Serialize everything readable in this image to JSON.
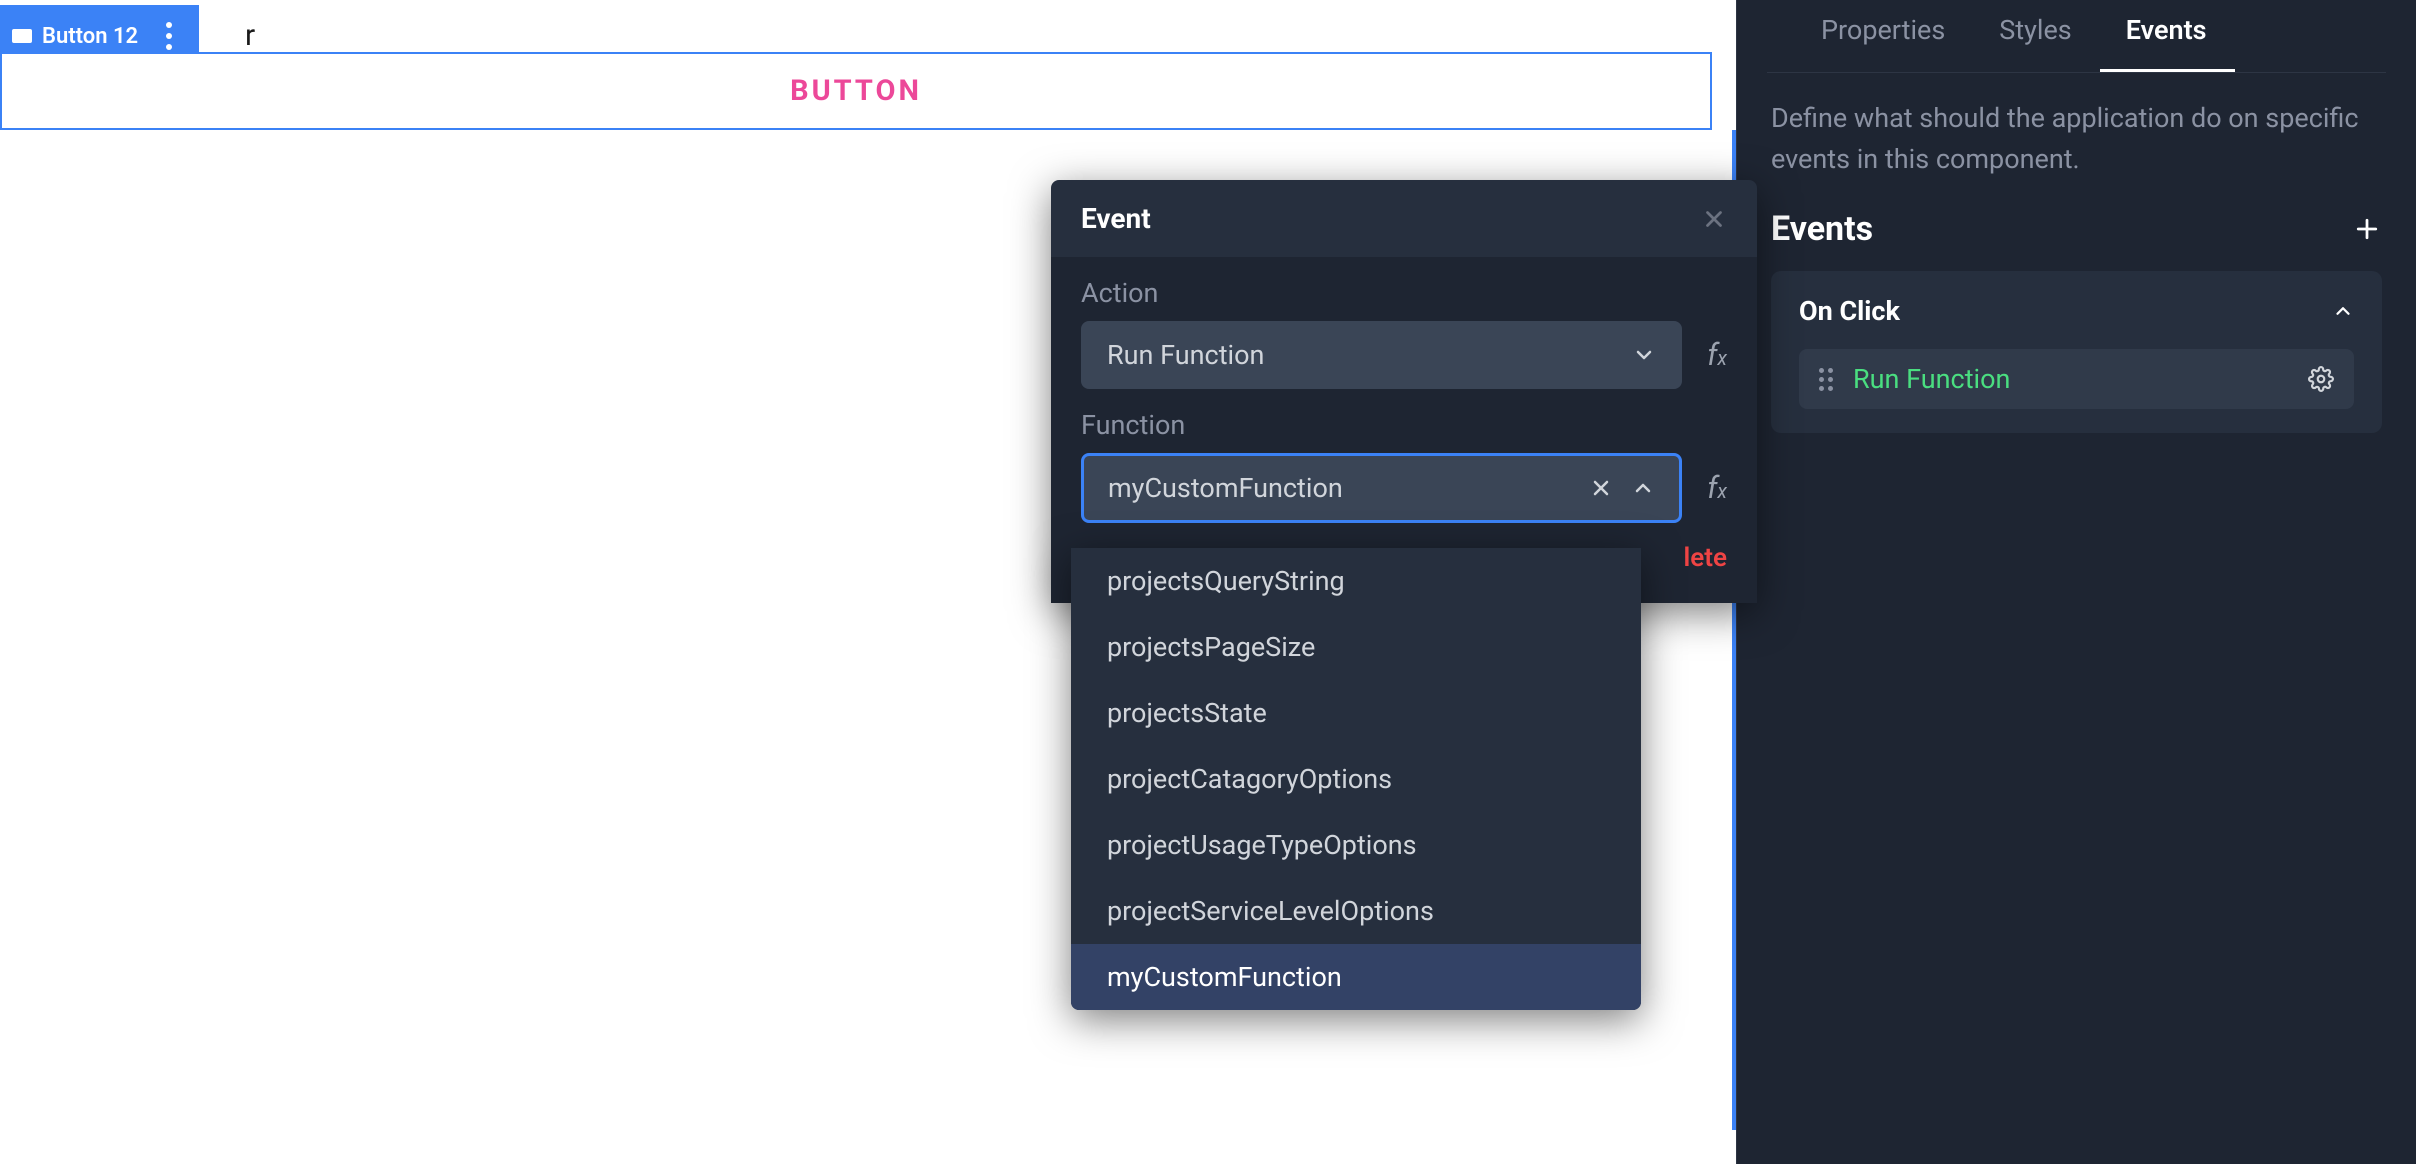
{
  "canvas": {
    "selection_label": "Button 12",
    "background_text": "r",
    "button_text": "BUTTON"
  },
  "inspector": {
    "tabs": {
      "properties": "Properties",
      "styles": "Styles",
      "events": "Events"
    },
    "description": "Define what should the application do on specific events in this component.",
    "events_heading": "Events",
    "event": {
      "name": "On Click",
      "action": "Run Function"
    }
  },
  "event_panel": {
    "title": "Event",
    "action_label": "Action",
    "action_value": "Run Function",
    "function_label": "Function",
    "function_value": "myCustomFunction",
    "delete_label": "lete"
  },
  "dropdown": {
    "items": [
      "projectsQueryString",
      "projectsPageSize",
      "projectsState",
      "projectCatagoryOptions",
      "projectUsageTypeOptions",
      "projectServiceLevelOptions",
      "myCustomFunction"
    ],
    "selected_index": 6
  }
}
